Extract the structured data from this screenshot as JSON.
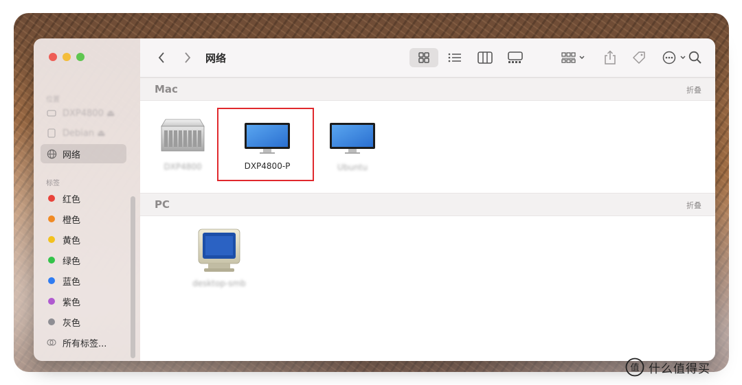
{
  "window": {
    "title": "网络"
  },
  "sidebar": {
    "favorites_header": "位置",
    "items": [
      {
        "label": "DXP4800 ⏏"
      },
      {
        "label": "Debian ⏏"
      },
      {
        "label": "网络"
      }
    ],
    "tags_header": "标签",
    "tags": [
      {
        "label": "红色",
        "color": "#e8423a"
      },
      {
        "label": "橙色",
        "color": "#f08a24"
      },
      {
        "label": "黄色",
        "color": "#f3c11d"
      },
      {
        "label": "绿色",
        "color": "#34c34a"
      },
      {
        "label": "蓝色",
        "color": "#2f7cf2"
      },
      {
        "label": "紫色",
        "color": "#b05ad0"
      },
      {
        "label": "灰色",
        "color": "#8e8e93"
      }
    ],
    "all_tags": "所有标签..."
  },
  "toolbar": {
    "icons": [
      "back-icon",
      "forward-icon",
      "icon-view-icon",
      "list-view-icon",
      "column-view-icon",
      "gallery-view-icon",
      "group-by-icon",
      "share-icon",
      "tag-icon",
      "more-icon",
      "search-icon"
    ]
  },
  "groups": [
    {
      "name": "Mac",
      "collapse": "折叠",
      "items": [
        {
          "label": "DXP4800",
          "icon": "server-icon",
          "blurred": true
        },
        {
          "label": "DXP4800-P",
          "icon": "imac-icon",
          "blurred": false,
          "highlighted": true
        },
        {
          "label": "Ubuntu",
          "icon": "imac-icon",
          "blurred": true
        }
      ]
    },
    {
      "name": "PC",
      "collapse": "折叠",
      "items": [
        {
          "label": "desktop-smb",
          "icon": "crt-monitor-icon",
          "blurred": true
        }
      ]
    }
  ],
  "watermark": {
    "text": "什么值得买",
    "icon": "smzdm-logo-icon"
  }
}
